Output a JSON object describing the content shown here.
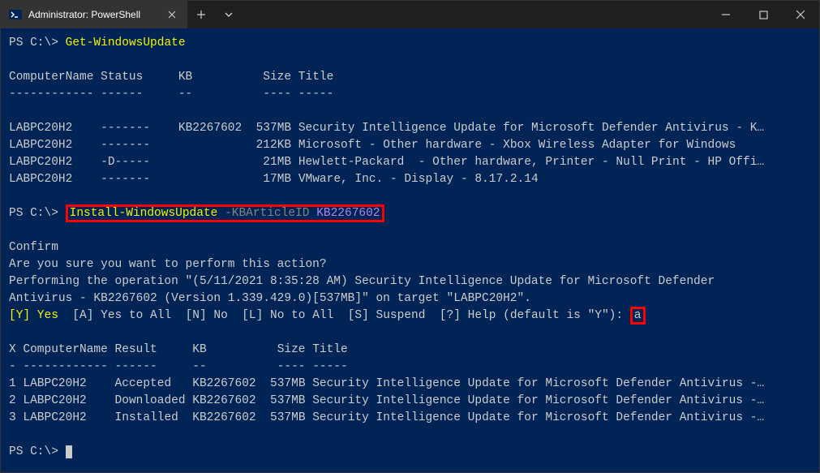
{
  "window": {
    "title": "Administrator: PowerShell"
  },
  "prompt": "PS C:\\>",
  "cmd1": "Get-WindowsUpdate",
  "header": {
    "cn": "ComputerName",
    "status": "Status",
    "kb": "KB",
    "size": "Size",
    "title": "Title"
  },
  "sep": {
    "cn": "------------",
    "status": "------",
    "kb": "--",
    "size": "----",
    "title": "-----"
  },
  "rows": [
    {
      "cn": "LABPC20H2",
      "status": "-------",
      "kb": "KB2267602",
      "size": "537MB",
      "title": "Security Intelligence Update for Microsoft Defender Antivirus - K…"
    },
    {
      "cn": "LABPC20H2",
      "status": "-------",
      "kb": "",
      "size": "212KB",
      "title": "Microsoft - Other hardware - Xbox Wireless Adapter for Windows"
    },
    {
      "cn": "LABPC20H2",
      "status": "-D-----",
      "kb": "",
      "size": "21MB",
      "title": "Hewlett-Packard  - Other hardware, Printer - Null Print - HP Offi…"
    },
    {
      "cn": "LABPC20H2",
      "status": "-------",
      "kb": "",
      "size": "17MB",
      "title": "VMware, Inc. - Display - 8.17.2.14"
    }
  ],
  "cmd2": {
    "verb": "Install-WindowsUpdate",
    "param": "-KBArticleID",
    "value": "KB2267602"
  },
  "confirm": {
    "heading": "Confirm",
    "question": "Are you sure you want to perform this action?",
    "detail1": "Performing the operation \"(5/11/2021 8:35:28 AM) Security Intelligence Update for Microsoft Defender",
    "detail2": "Antivirus - KB2267602 (Version 1.339.429.0)[537MB]\" on target \"LABPC20H2\".",
    "options": {
      "y": "[Y] Yes",
      "a": "[A] Yes to All",
      "n": "[N] No",
      "l": "[L] No to All",
      "s": "[S] Suspend",
      "h": "[?] Help (default is \"Y\"):"
    },
    "input": "a"
  },
  "header2": {
    "x": "X",
    "cn": "ComputerName",
    "result": "Result",
    "kb": "KB",
    "size": "Size",
    "title": "Title"
  },
  "sep2": {
    "x": "-",
    "cn": "------------",
    "result": "------",
    "kb": "--",
    "size": "----",
    "title": "-----"
  },
  "rows2": [
    {
      "x": "1",
      "cn": "LABPC20H2",
      "result": "Accepted",
      "kb": "KB2267602",
      "size": "537MB",
      "title": "Security Intelligence Update for Microsoft Defender Antivirus -…"
    },
    {
      "x": "2",
      "cn": "LABPC20H2",
      "result": "Downloaded",
      "kb": "KB2267602",
      "size": "537MB",
      "title": "Security Intelligence Update for Microsoft Defender Antivirus -…"
    },
    {
      "x": "3",
      "cn": "LABPC20H2",
      "result": "Installed",
      "kb": "KB2267602",
      "size": "537MB",
      "title": "Security Intelligence Update for Microsoft Defender Antivirus -…"
    }
  ]
}
